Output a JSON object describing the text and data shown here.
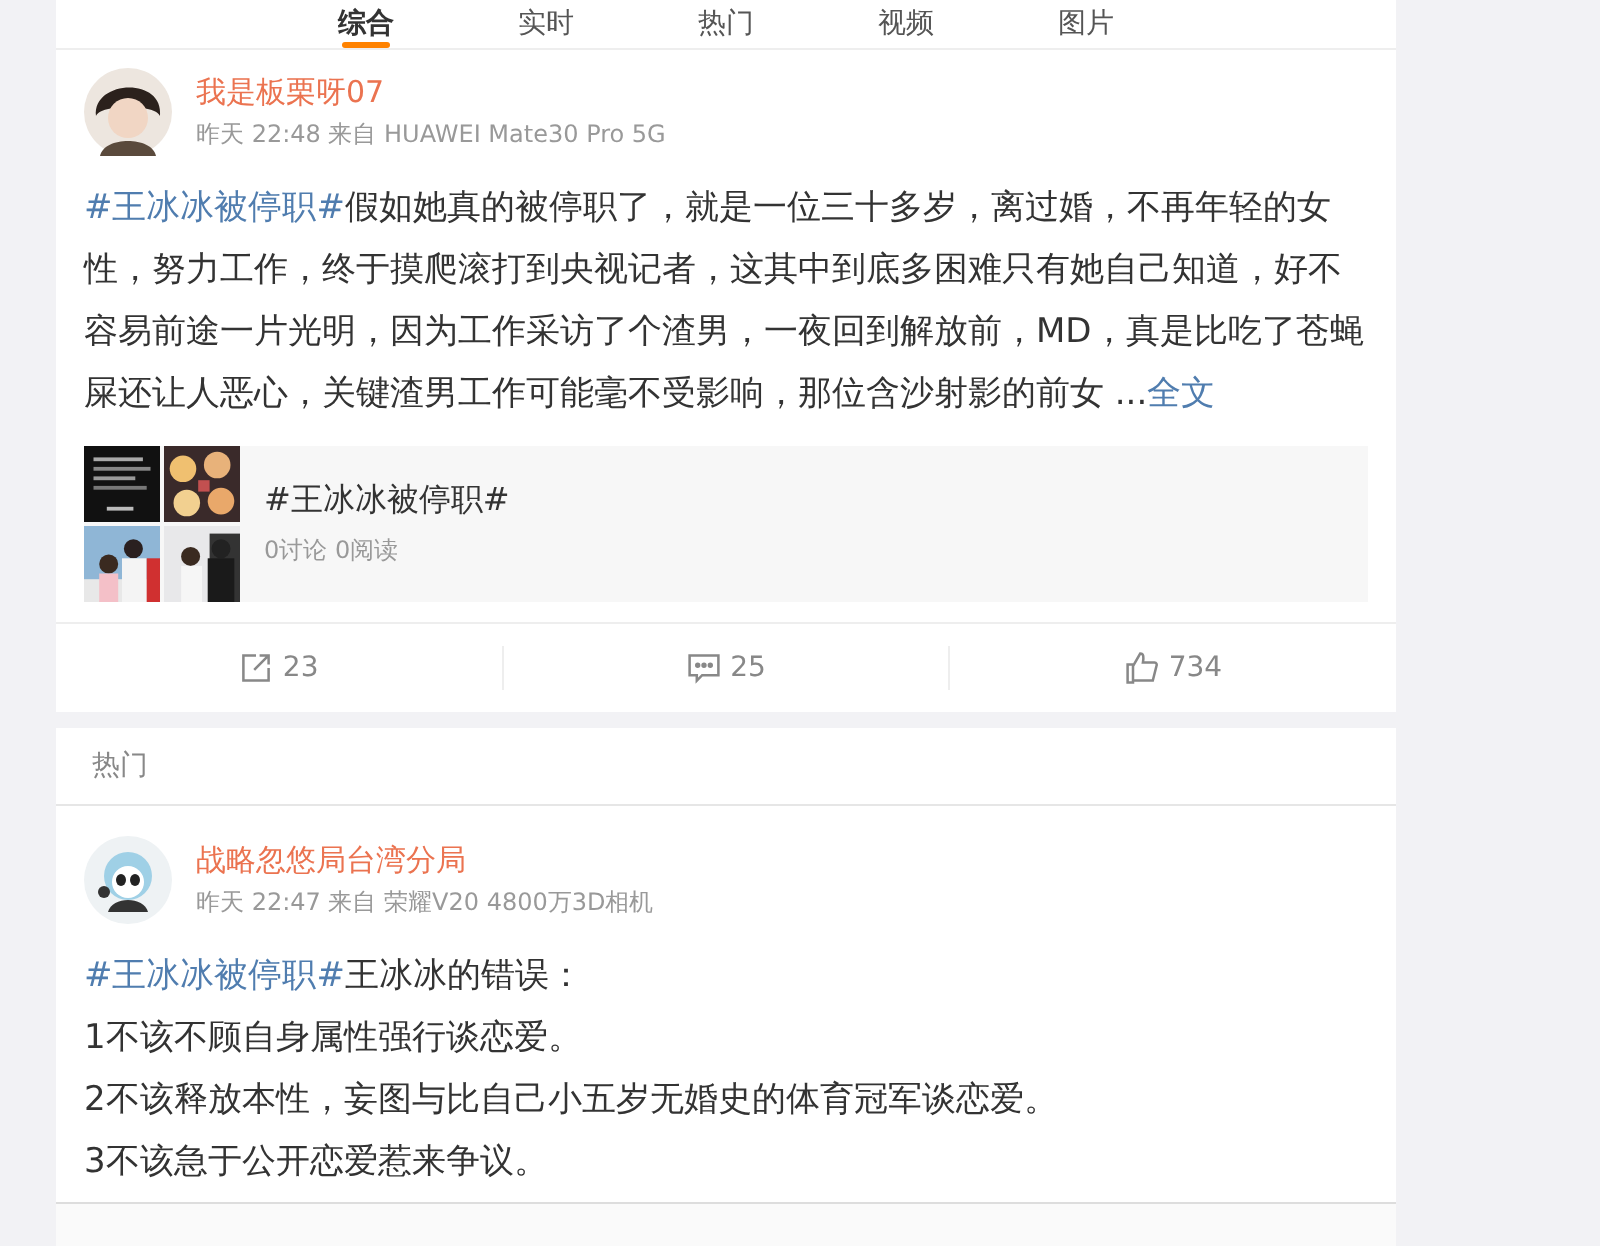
{
  "tabs": [
    {
      "label": "综合",
      "selected": true
    },
    {
      "label": "实时",
      "selected": false
    },
    {
      "label": "热门",
      "selected": false
    },
    {
      "label": "视频",
      "selected": false
    },
    {
      "label": "图片",
      "selected": false
    }
  ],
  "posts": [
    {
      "author": "我是板栗呀07",
      "meta": "昨天 22:48 来自 HUAWEI Mate30 Pro 5G",
      "tag": "#王冰冰被停职#",
      "lines": [
        "假如她真的被停职了，就是一位三十多岁，离过婚，不再年轻的女性，努力工作，终于摸爬滚打到央视记者，这其中到底多困难只有她自己知道，好不容易前途一片光明，因为工作采访了个渣男，一夜回到解放前，MD，真是比吃了苍蝇屎还让人恶心，关键渣男工作可能毫不受影响，那位含沙射影的前女 ..."
      ],
      "more": "全文",
      "topic": {
        "title": "#王冰冰被停职#",
        "stats": "0讨论 0阅读"
      },
      "actions": [
        {
          "kind": "share",
          "count": "23"
        },
        {
          "kind": "comment",
          "count": "25"
        },
        {
          "kind": "like",
          "count": "734"
        }
      ]
    }
  ],
  "section": {
    "title": "热门"
  },
  "hot_posts": [
    {
      "author": "战略忽悠局台湾分局",
      "meta": "昨天 22:47 来自 荣耀V20 4800万3D相机",
      "tag": "#王冰冰被停职#",
      "lines": [
        "王冰冰的错误：",
        "1不该不顾自身属性强行谈恋爱。",
        "2不该释放本性，妄图与比自己小五岁无婚史的体育冠军谈恋爱。",
        "3不该急于公开恋爱惹来争议。"
      ]
    }
  ]
}
